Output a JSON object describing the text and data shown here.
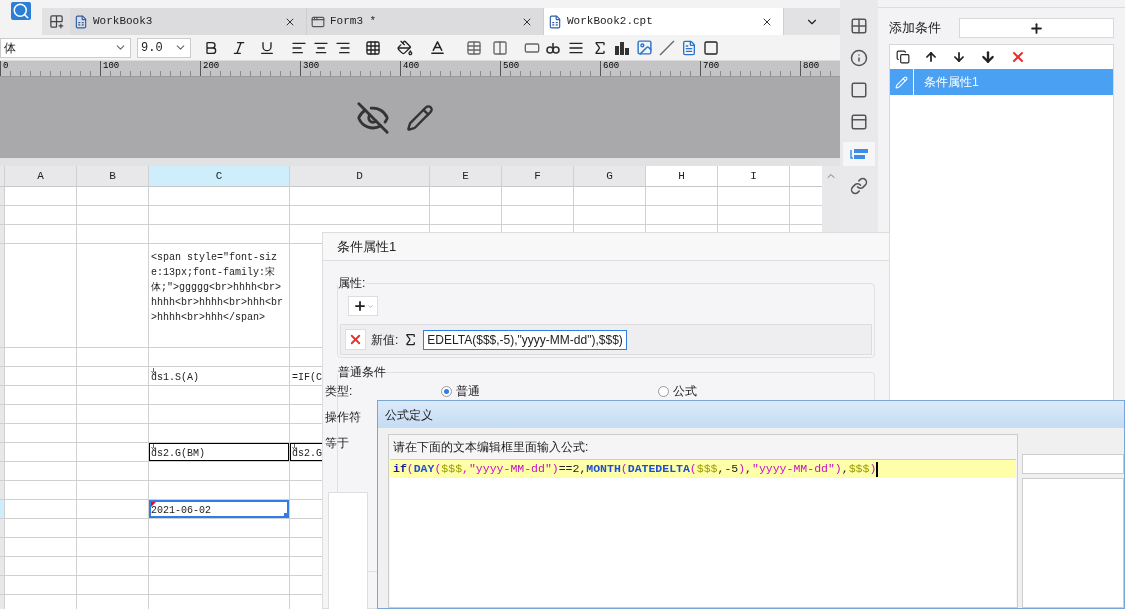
{
  "tabs": [
    {
      "label": "WorkBook3",
      "selected": false,
      "kind": "workbook"
    },
    {
      "label": "Form3 *",
      "selected": false,
      "kind": "form"
    },
    {
      "label": "WorkBook2.cpt",
      "selected": true,
      "kind": "workbook"
    }
  ],
  "format_toolbar": {
    "font": "体",
    "size": "9.0"
  },
  "ruler": [
    "0",
    "100",
    "200",
    "300",
    "400",
    "500",
    "600",
    "700",
    "800"
  ],
  "sheet": {
    "columns": [
      {
        "label": "A",
        "selected": false
      },
      {
        "label": "B",
        "selected": false
      },
      {
        "label": "C",
        "selected": true
      },
      {
        "label": "D",
        "selected": false
      },
      {
        "label": "E",
        "selected": false
      },
      {
        "label": "F",
        "selected": false
      },
      {
        "label": "G",
        "selected": false
      },
      {
        "label": "H",
        "selected": false
      },
      {
        "label": "I",
        "selected": false
      }
    ],
    "rows": [
      {
        "selected": false
      },
      {
        "selected": false
      },
      {
        "selected": false
      },
      {
        "selected": false,
        "column_c": {
          "text": "<span style=\"font-size:13px;font-family:宋体;\">ggggg<br>hhhh<br>hhhh<br>hhhh<br>hhh<br>hhhh<br>hhh</span>",
          "expand": false,
          "bordered": false,
          "selected": false
        }
      },
      {
        "selected": false
      },
      {
        "selected": false,
        "column_c": {
          "text": "ds1.S(A)",
          "expand": true,
          "bordered": false,
          "selected": false
        },
        "column_d": {
          "text": "=IF(C",
          "expand": false,
          "bordered": false,
          "selected": false
        }
      },
      {
        "selected": false
      },
      {
        "selected": false
      },
      {
        "selected": false
      },
      {
        "selected": false,
        "column_c": {
          "text": "ds2.G(BM)",
          "expand": true,
          "bordered": true,
          "selected": false
        },
        "column_d": {
          "text": "ds2.G",
          "expand": true,
          "bordered": true,
          "selected": false
        }
      },
      {
        "selected": false
      },
      {
        "selected": false
      },
      {
        "selected": true,
        "column_c": {
          "text": "2021-06-02",
          "expand": false,
          "bordered": false,
          "selected": true,
          "flagged": true
        }
      },
      {
        "selected": false
      },
      {
        "selected": false
      },
      {
        "selected": false
      },
      {
        "selected": false
      },
      {
        "selected": false
      }
    ]
  },
  "side_tabs": [
    {
      "kind": "cell",
      "selected": false
    },
    {
      "kind": "cell-info",
      "selected": false
    },
    {
      "kind": "frame",
      "selected": false
    },
    {
      "kind": "widget",
      "selected": false
    },
    {
      "kind": "condition",
      "selected": true
    },
    {
      "kind": "link",
      "selected": false
    }
  ],
  "condition_panel": {
    "add_label": "添加条件",
    "items": [
      {
        "label": "条件属性1",
        "selected": true
      }
    ]
  },
  "condition_dialog": {
    "title": "条件属性1",
    "property_group": "属性:",
    "new_value_label": "新值:",
    "new_value": "EDELTA($$$,-5),\"yyyy-MM-dd\"),$$$)",
    "common_group": "普通条件",
    "type_label": "类型:",
    "types": [
      {
        "label": "普通",
        "selected": true
      },
      {
        "label": "公式",
        "selected": false
      }
    ],
    "operator_label": "操作符",
    "operator_value": "等于"
  },
  "formula_dialog": {
    "title": "公式定义",
    "prompt": "请在下面的文本编辑框里面输入公式:",
    "tokens": [
      {
        "text": "if",
        "kind": "keyword"
      },
      {
        "text": "(",
        "kind": "paren"
      },
      {
        "text": "DAY",
        "kind": "function"
      },
      {
        "text": "(",
        "kind": "paren"
      },
      {
        "text": "$$$",
        "kind": "variable"
      },
      {
        "text": ",",
        "kind": "paren"
      },
      {
        "text": "\"yyyy-MM-dd\"",
        "kind": "string"
      },
      {
        "text": ")",
        "kind": "paren"
      },
      {
        "text": "==2,",
        "kind": "plain"
      },
      {
        "text": "MONTH",
        "kind": "function"
      },
      {
        "text": "(",
        "kind": "paren"
      },
      {
        "text": "DATEDELTA",
        "kind": "function"
      },
      {
        "text": "(",
        "kind": "paren"
      },
      {
        "text": "$$$",
        "kind": "variable"
      },
      {
        "text": ",-5",
        "kind": "plain"
      },
      {
        "text": ")",
        "kind": "paren"
      },
      {
        "text": ",",
        "kind": "plain"
      },
      {
        "text": "\"yyyy-MM-dd\"",
        "kind": "string"
      },
      {
        "text": ")",
        "kind": "paren"
      },
      {
        "text": ",",
        "kind": "plain"
      },
      {
        "text": "$$$",
        "kind": "variable"
      },
      {
        "text": ")",
        "kind": "paren"
      }
    ]
  }
}
